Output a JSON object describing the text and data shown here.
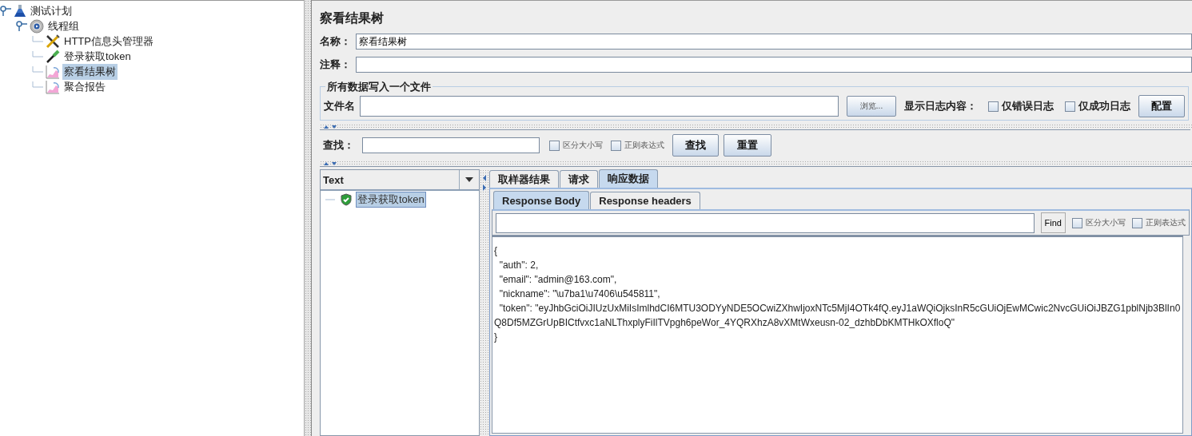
{
  "tree": {
    "items": [
      {
        "label": "测试计划",
        "kind": "flask",
        "expanded": true,
        "selected": false,
        "children": [
          {
            "label": "线程组",
            "kind": "gear",
            "expanded": true,
            "selected": false,
            "children": [
              {
                "label": "HTTP信息头管理器",
                "kind": "tools",
                "selected": false
              },
              {
                "label": "登录获取token",
                "kind": "pipette",
                "selected": false
              },
              {
                "label": "察看结果树",
                "kind": "chart",
                "selected": true
              },
              {
                "label": "聚合报告",
                "kind": "chart",
                "selected": false
              }
            ]
          }
        ]
      }
    ]
  },
  "panel": {
    "title": "察看结果树",
    "name_label": "名称：",
    "name_value": "察看结果树",
    "comment_label": "注释：",
    "file_group": {
      "title": "所有数据写入一个文件",
      "filename_label": "文件名",
      "browse_button": "浏览...",
      "log_label": "显示日志内容：",
      "checks": [
        {
          "label": "仅错误日志",
          "checked": false
        },
        {
          "label": "仅成功日志",
          "checked": false
        }
      ],
      "config_button": "配置"
    }
  },
  "search": {
    "label": "查找：",
    "checks": [
      {
        "label": "区分大小写",
        "checked": false
      },
      {
        "label": "正则表达式",
        "checked": false
      }
    ],
    "buttons": [
      "查找",
      "重置"
    ]
  },
  "results": {
    "renderer": "Text",
    "samples": [
      {
        "label": "登录获取token",
        "selected": true
      }
    ],
    "tabs": [
      {
        "label": "取样器结果",
        "selected": false
      },
      {
        "label": "请求",
        "selected": false
      },
      {
        "label": "响应数据",
        "selected": true
      }
    ],
    "subtabs": [
      {
        "label": "Response Body",
        "selected": true
      },
      {
        "label": "Response headers",
        "selected": false
      }
    ],
    "find_button": "Find",
    "find_checks": [
      {
        "label": "区分大小写",
        "checked": false
      },
      {
        "label": "正则表达式",
        "checked": false
      }
    ],
    "body_lines": [
      "{",
      "  \"auth\": 2,",
      "  \"email\": \"admin@163.com\",",
      "  \"nickname\": \"\\u7ba1\\u7406\\u545811\",",
      "  \"token\": \"eyJhbGciOiJIUzUxMiIsImlhdCI6MTU3ODYyNDE5OCwiZXhwIjoxNTc5MjI4OTk4fQ.eyJ1aWQiOjksInR5cGUiOjEwMCwic2NvcGUiOiJBZG1pblNjb3BlIn0",
      "Q8Df5MZGrUpBICtfvxc1aNLThxplyFiIlTVpgh6peWor_4YQRXhzA8vXMtWxeusn-02_dzhbDbKMTHkOXfloQ\"",
      "}"
    ]
  }
}
